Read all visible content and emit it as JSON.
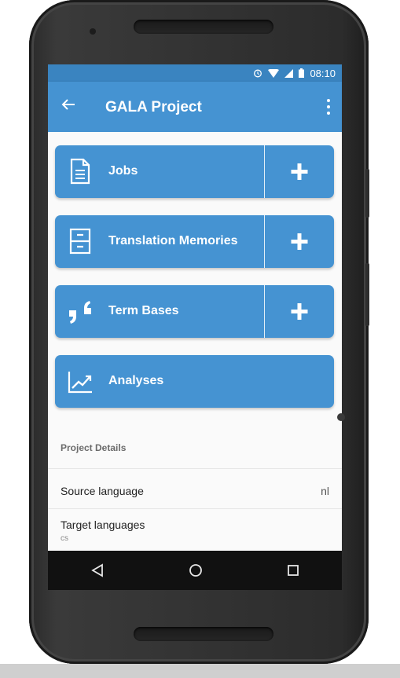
{
  "status_bar": {
    "time": "08:10",
    "icons": [
      "alarm-icon",
      "wifi-icon",
      "signal-icon",
      "battery-icon"
    ]
  },
  "app_bar": {
    "title": "GALA Project",
    "back_icon": "arrow-left-icon",
    "menu_icon": "more-vert-icon"
  },
  "cards": [
    {
      "label": "Jobs",
      "icon": "document-icon",
      "has_add": true
    },
    {
      "label": "Translation Memories",
      "icon": "cabinet-icon",
      "has_add": true
    },
    {
      "label": "Term Bases",
      "icon": "quote-icon",
      "has_add": true
    },
    {
      "label": "Analyses",
      "icon": "trend-chart-icon",
      "has_add": false
    }
  ],
  "project_details": {
    "section_title": "Project Details",
    "source_language_label": "Source language",
    "source_language_value": "nl",
    "target_languages_label": "Target languages",
    "target_languages_value": "cs"
  },
  "nav_bar": {
    "icons": [
      "back-triangle-icon",
      "home-circle-icon",
      "recents-square-icon"
    ]
  },
  "colors": {
    "accent": "#4593d2",
    "status_bar": "#3a84c0",
    "nav_bar": "#111111"
  }
}
